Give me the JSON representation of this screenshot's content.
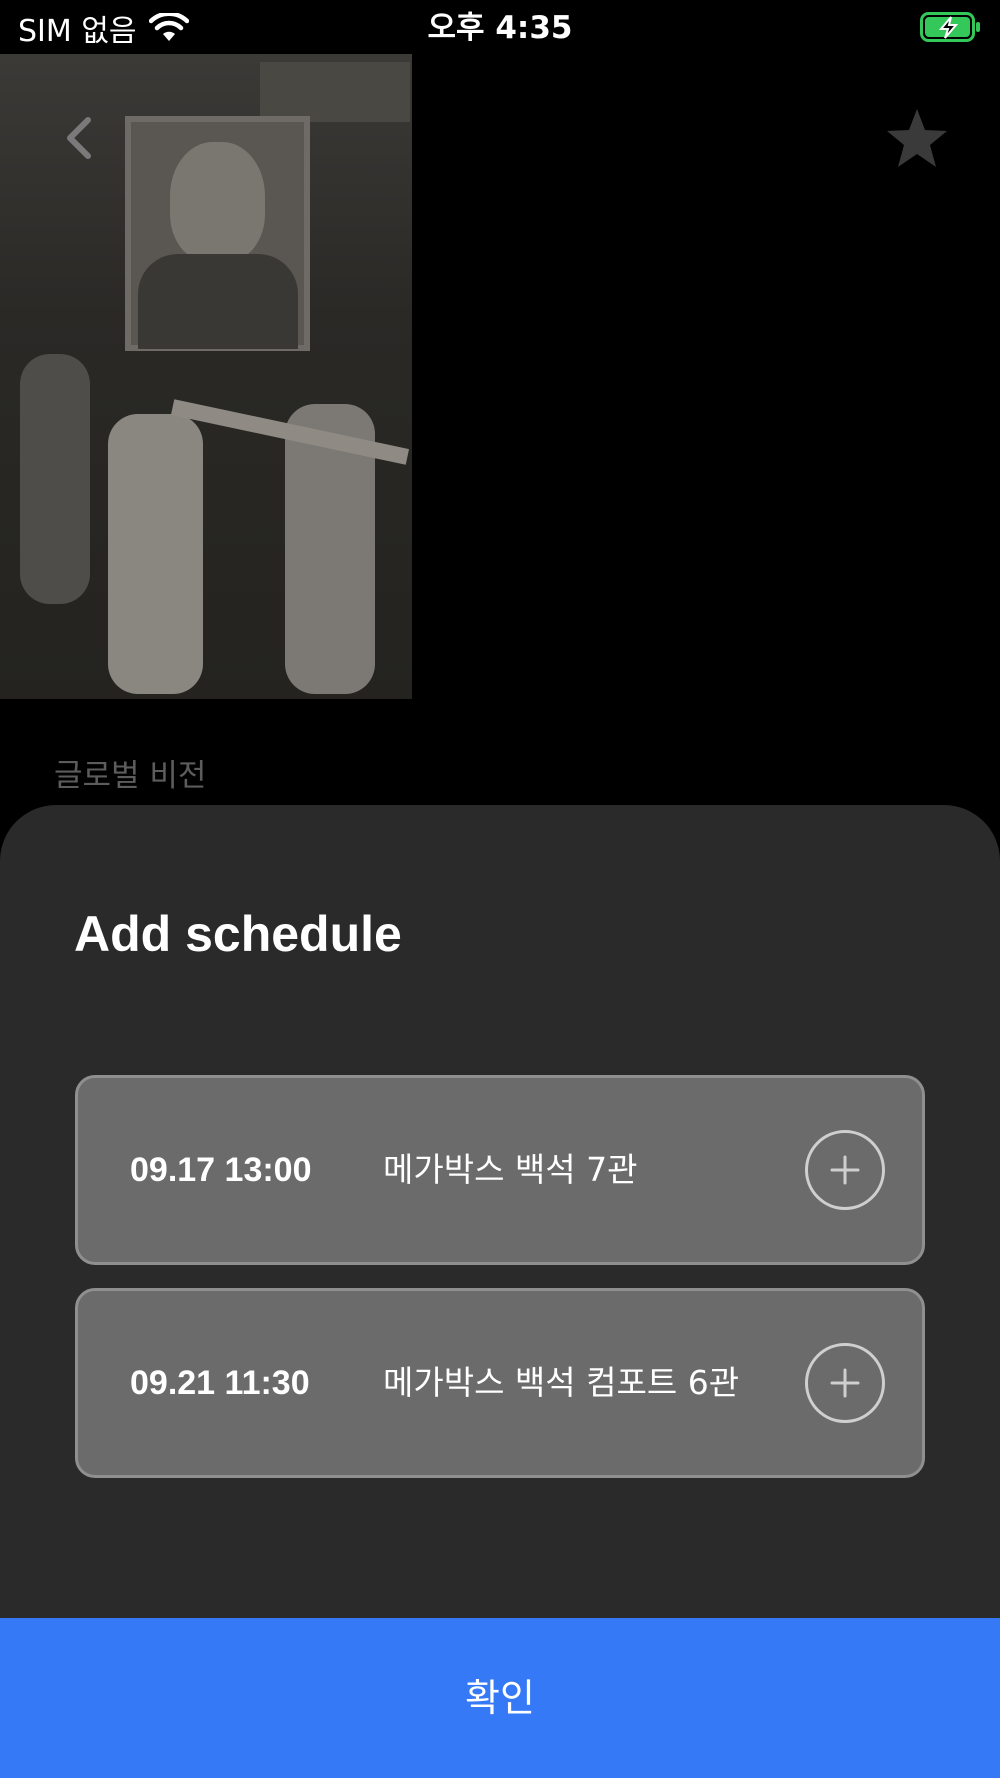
{
  "status_bar": {
    "carrier": "SIM 없음",
    "time": "오후 4:35",
    "battery_color": "#34c759"
  },
  "background": {
    "caption": "글로벌 비전",
    "icons": {
      "back": "chevron-left-icon",
      "favorite": "star-icon"
    }
  },
  "sheet": {
    "title": "Add schedule",
    "schedules": [
      {
        "datetime": "09.17 13:00",
        "place": "메가박스 백석 7관"
      },
      {
        "datetime": "09.21 11:30",
        "place": "메가박스 백석 컴포트 6관"
      }
    ]
  },
  "confirm": {
    "label": "확인",
    "color": "#3579f6"
  }
}
